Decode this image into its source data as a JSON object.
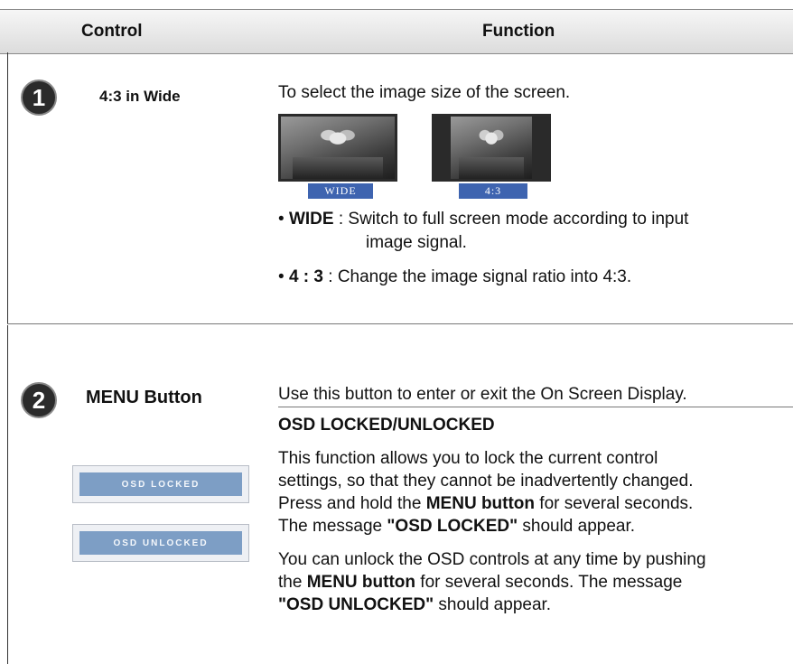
{
  "header": {
    "control": "Control",
    "function": "Function"
  },
  "sections": [
    {
      "number": "1",
      "control": "4:3 in Wide",
      "intro": "To select the image size of the screen.",
      "thumbs": [
        {
          "tag": "WIDE"
        },
        {
          "tag": "4:3"
        }
      ],
      "bullets": [
        {
          "term": "WIDE",
          "sep": " : ",
          "line1": "Switch to full screen mode according to input",
          "line2": "image signal."
        },
        {
          "term": "4 : 3",
          "sep": " : ",
          "line1": "Change the image signal ratio into 4:3."
        }
      ]
    },
    {
      "number": "2",
      "control": "MENU Button",
      "intro": "Use this button to enter or exit the On Screen Display.",
      "subheading": "OSD LOCKED/UNLOCKED",
      "osd_locked": "OSD LOCKED",
      "osd_unlocked": "OSD UNLOCKED",
      "para1": {
        "l1": "This function allows you to lock the current control",
        "l2": "settings, so that they cannot be inadvertently changed.",
        "l3_pre": "Press and hold the ",
        "l3_bold": "MENU button",
        "l3_post": " for several seconds.",
        "l4_pre": "The message ",
        "l4_bold": "\"OSD LOCKED\"",
        "l4_post": " should appear."
      },
      "para2": {
        "l1": "You can unlock the OSD controls at any time by pushing",
        "l2_pre": "the ",
        "l2_bold": "MENU button",
        "l2_post": " for several seconds. The message",
        "l3_bold": "\"OSD UNLOCKED\"",
        "l3_post": " should appear."
      }
    }
  ]
}
